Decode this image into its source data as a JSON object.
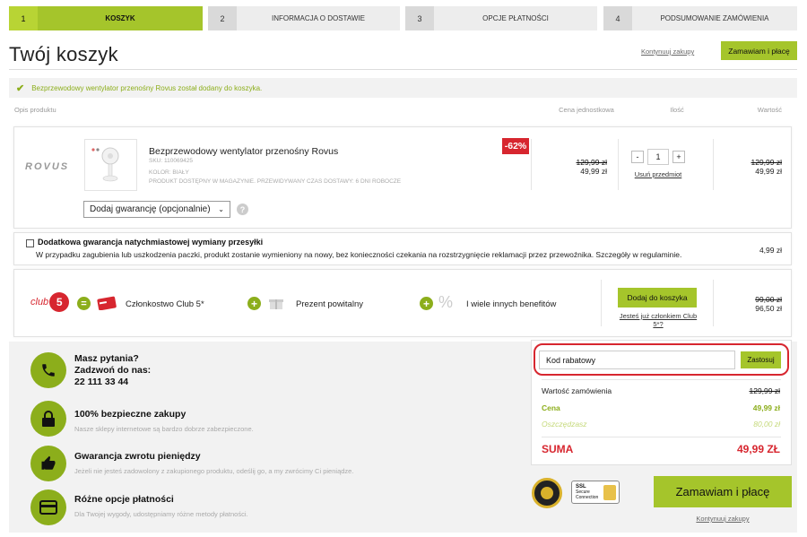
{
  "steps": [
    {
      "num": "1",
      "label": "KOSZYK"
    },
    {
      "num": "2",
      "label": "INFORMACJA O DOSTAWIE"
    },
    {
      "num": "3",
      "label": "OPCJE PŁATNOŚCI"
    },
    {
      "num": "4",
      "label": "PODSUMOWANIE ZAMÓWIENIA"
    }
  ],
  "page": {
    "title": "Twój koszyk",
    "continue_link": "Kontynuuj zakupy",
    "order_button": "Zamawiam i płacę"
  },
  "notice": "Bezprzewodowy wentylator przenośny Rovus został dodany do koszyka.",
  "table_headers": {
    "description": "Opis produktu",
    "unit_price": "Cena jednostkowa",
    "quantity": "Ilość",
    "value": "Wartość"
  },
  "product": {
    "brand": "ROVUS",
    "name": "Bezprzewodowy wentylator przenośny Rovus",
    "sku": "SKU: 110069425",
    "color": "KOLOR: BIAŁY",
    "availability": "PRODUKT DOSTĘPNY W MAGAZYNIE. PRZEWIDYWANY CZAS DOSTAWY: 6 DNI ROBOCZE",
    "discount_badge": "-62%",
    "old_price": "129,99 zł",
    "price": "49,99 zł",
    "qty_minus": "-",
    "qty": "1",
    "qty_plus": "+",
    "remove": "Usuń przedmiot",
    "total_old": "129,99 zł",
    "total": "49,99 zł",
    "warranty_select": "Dodaj gwarancję (opcjonalnie)",
    "help": "?"
  },
  "insurance": {
    "title": "Dodatkowa gwarancja natychmiastowej wymiany przesyłki",
    "description": "W przypadku zagubienia lub uszkodzenia paczki, produkt zostanie wymieniony na nowy, bez konieczności czekania na rozstrzygnięcie reklamacji przez przewoźnika. Szczegóły w regulaminie.",
    "price": "4,99 zł"
  },
  "club": {
    "logo": "club",
    "logo_num": "5",
    "eq": "=",
    "plus1": "+",
    "plus2": "+",
    "membership": "Członkostwo Club 5*",
    "gift": "Prezent powitalny",
    "percent": "%",
    "benefits": "I wiele innych benefitów",
    "add_button": "Dodaj do koszyka",
    "member_link": "Jesteś już członkiem Club 5*?",
    "old_price": "99,00 zł",
    "price": "96,50 zł"
  },
  "support": {
    "phone_title": "Masz pytania?",
    "phone_sub": "Zadzwoń do nas:",
    "phone_number": "22 111 33 44",
    "secure_title": "100% bezpieczne zakupy",
    "secure_desc": "Nasze sklepy internetowe są bardzo dobrze zabezpieczone.",
    "refund_title": "Gwarancja zwrotu pieniędzy",
    "refund_desc": "Jeżeli nie jesteś zadowolony z zakupionego produktu, odeślij go, a my zwrócimy Ci pieniądze.",
    "payment_title": "Różne opcje płatności",
    "payment_desc": "Dla Twojej wygody, udostępniamy różne metody płatności."
  },
  "summary": {
    "coupon_placeholder": "Kod rabatowy",
    "apply": "Zastosuj",
    "order_value_label": "Wartość zamówienia",
    "order_value": "129,99 zł",
    "price_label": "Cena",
    "price": "49,99 zł",
    "savings_label": "Oszczędzasz",
    "savings": "80,00 zł",
    "total_label": "SUMA",
    "total": "49,99 ZŁ"
  },
  "badges": {
    "ssl_line1": "SSL",
    "ssl_line2": "Secure",
    "ssl_line3": "Connection"
  },
  "colors": {
    "accent": "#a5c52b",
    "accent_text": "#8cae1b",
    "sale": "#d7262f",
    "highlight": "#d7262f"
  }
}
